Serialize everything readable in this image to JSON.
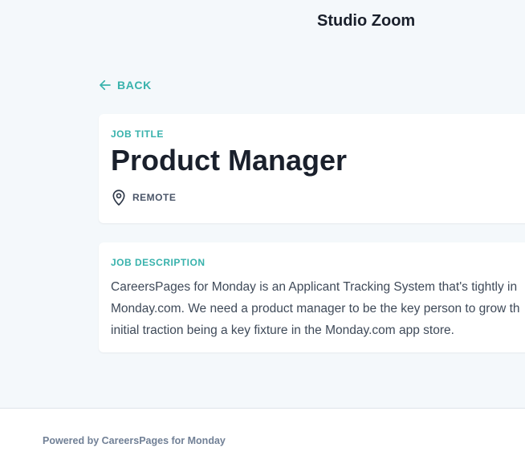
{
  "header": {
    "brand": "Studio Zoom"
  },
  "nav": {
    "back_label": "BACK"
  },
  "job": {
    "title_label": "JOB TITLE",
    "title": "Product Manager",
    "location": "REMOTE",
    "description_label": "JOB DESCRIPTION",
    "description_lines": [
      "CareersPages for Monday is an Applicant Tracking System that's tightly in",
      "Monday.com. We need a product manager to be the key person to grow th",
      "initial traction being a key fixture in the Monday.com app store."
    ]
  },
  "footer": {
    "powered_by": "Powered by CareersPages for Monday"
  },
  "colors": {
    "accent": "#38b2ac",
    "background": "#f4f8fb",
    "card": "#ffffff",
    "heading": "#1a202c",
    "muted": "#718096"
  },
  "icons": {
    "back": "arrow-left-icon",
    "location": "map-pin-icon"
  }
}
